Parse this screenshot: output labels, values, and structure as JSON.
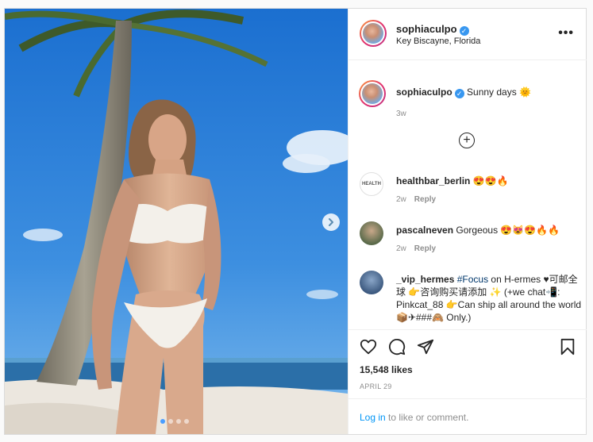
{
  "post": {
    "username": "sophiaculpo",
    "location": "Key Biscayne, Florida",
    "more_label": "•••"
  },
  "caption": {
    "username": "sophiaculpo",
    "text": "Sunny days 🌞",
    "time": "3w"
  },
  "load_more_label": "+",
  "comments": [
    {
      "username": "healthbar_berlin",
      "text": "😍😍🔥",
      "time": "2w",
      "reply": "Reply"
    },
    {
      "username": "pascalneven",
      "text": "Gorgeous 😍😻😍🔥🔥",
      "time": "2w",
      "reply": "Reply"
    },
    {
      "username": "_vip_hermes",
      "hashtag": "#Focus",
      "text_after": " on H-ermes ♥可邮全球 👉咨询购买请添加 ✨ (+we chat📲: Pinkcat_88 👉Can ship all around the world📦✈###🙈 Only.)"
    }
  ],
  "likes": "15,548 likes",
  "date": "APRIL 29",
  "login": {
    "link": "Log in",
    "rest": " to like or comment."
  },
  "carousel": {
    "total": 4,
    "active_index": 0
  },
  "colors": {
    "accent": "#0095f6",
    "verified": "#3897f0",
    "text": "#262626",
    "muted": "#8e8e8e"
  }
}
